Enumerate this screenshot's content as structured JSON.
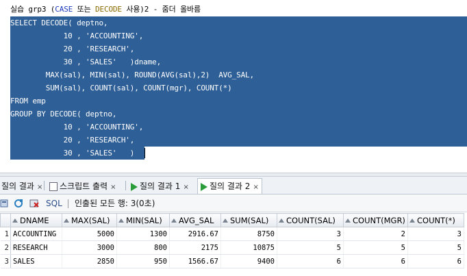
{
  "editor": {
    "title_parts": [
      "실습 grp3 (",
      "CASE",
      " 또는 ",
      "DECODE",
      " 사용)2 - 줌더 올바름"
    ],
    "lines": [
      "SELECT DECODE( deptno,",
      "            10 , 'ACCOUNTING',",
      "            20 , 'RESEARCH',",
      "            30 , 'SALES'   )dname,",
      "        MAX(sal), MIN(sal), ROUND(AVG(sal),2)  AVG_SAL,",
      "        SUM(sal), COUNT(sal), COUNT(mgr), COUNT(*)",
      "FROM emp",
      "GROUP BY DECODE( deptno,",
      "            10 , 'ACCOUNTING',",
      "            20 , 'RESEARCH',",
      "            30 , 'SALES'   )"
    ]
  },
  "tabs": [
    {
      "label": "질의 결과",
      "close": "×"
    },
    {
      "label": "스크립트 출력",
      "close": "×"
    },
    {
      "label": "질의 결과 1",
      "close": "×"
    },
    {
      "label": "질의 결과 2",
      "close": "×"
    }
  ],
  "toolbar": {
    "sql_label": "SQL",
    "status": "인출된 모든 행: 3(0초)"
  },
  "grid": {
    "columns": [
      "DNAME",
      "MAX(SAL)",
      "MIN(SAL)",
      "AVG_SAL",
      "SUM(SAL)",
      "COUNT(SAL)",
      "COUNT(MGR)",
      "COUNT(*)"
    ],
    "rows": [
      {
        "n": "1",
        "cells": [
          "ACCOUNTING",
          "5000",
          "1300",
          "2916.67",
          "8750",
          "3",
          "2",
          "3"
        ]
      },
      {
        "n": "2",
        "cells": [
          "RESEARCH",
          "3000",
          "800",
          "2175",
          "10875",
          "5",
          "5",
          "5"
        ]
      },
      {
        "n": "3",
        "cells": [
          "SALES",
          "2850",
          "950",
          "1566.67",
          "9400",
          "6",
          "6",
          "6"
        ]
      }
    ]
  },
  "colors": {
    "selection": "#2f5f97",
    "keyword": "#1c39bd",
    "play": "#2a9d3a"
  }
}
